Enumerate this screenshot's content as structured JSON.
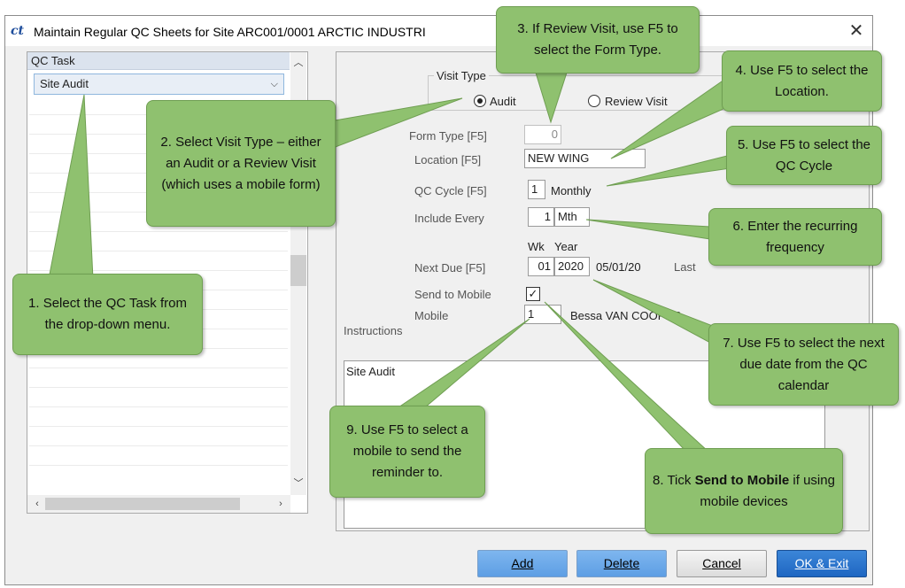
{
  "window": {
    "app_icon": "ct",
    "title": "Maintain Regular QC Sheets for Site ARC001/0001 ARCTIC INDUSTRI",
    "close_label": "✕"
  },
  "left_panel": {
    "header": "QC Task",
    "selected_task": "Site Audit"
  },
  "visit_type": {
    "legend": "Visit Type",
    "options": [
      {
        "label": "Audit",
        "selected": true
      },
      {
        "label": "Review Visit",
        "selected": false
      }
    ]
  },
  "form": {
    "form_type_label": "Form Type [F5]",
    "form_type_value": "0",
    "location_label": "Location [F5]",
    "location_value": "NEW WING",
    "qc_cycle_label": "QC Cycle [F5]",
    "qc_cycle_value": "1",
    "qc_cycle_text": "Monthly",
    "include_every_label": "Include Every",
    "include_every_value": "1",
    "include_every_unit": "Mth",
    "wk_header": "Wk",
    "year_header": "Year",
    "next_due_label": "Next Due [F5]",
    "next_due_week": "01",
    "next_due_year": "2020",
    "next_due_date": "05/01/20",
    "last_label": "Last",
    "send_to_mobile_label": "Send to Mobile",
    "send_to_mobile_checked": true,
    "check_mark": "✓",
    "mobile_label": "Mobile",
    "mobile_value": "1",
    "mobile_name": "Bessa VAN COOPER",
    "instructions_label": "Instructions",
    "instructions_text": "Site Audit"
  },
  "buttons": {
    "add": "Add",
    "delete": "Delete",
    "cancel": "Cancel",
    "ok_exit": "OK & Exit"
  },
  "callouts": [
    {
      "id": "1",
      "text": "1. Select the QC Task from the drop-down menu."
    },
    {
      "id": "2",
      "text": "2. Select Visit Type – either an Audit or a Review Visit (which uses a mobile form)"
    },
    {
      "id": "3",
      "text": "3. If Review Visit, use F5 to select the Form Type."
    },
    {
      "id": "4",
      "text": "4. Use F5 to select the Location."
    },
    {
      "id": "5",
      "text": "5. Use F5 to select the QC Cycle"
    },
    {
      "id": "6",
      "text": "6. Enter the recurring frequency"
    },
    {
      "id": "7",
      "text": "7. Use F5 to select the next due date from the QC calendar"
    },
    {
      "id": "8",
      "text_before": "8. Tick ",
      "text_bold": "Send to Mobile",
      "text_after": " if using mobile devices"
    },
    {
      "id": "9",
      "text": "9. Use F5 to select a mobile to send the reminder to."
    }
  ],
  "colors": {
    "callout_fill": "#8fc16f",
    "callout_border": "#6f9e52",
    "button_blue": "#5d9ee4",
    "button_ok": "#1e66c2"
  }
}
